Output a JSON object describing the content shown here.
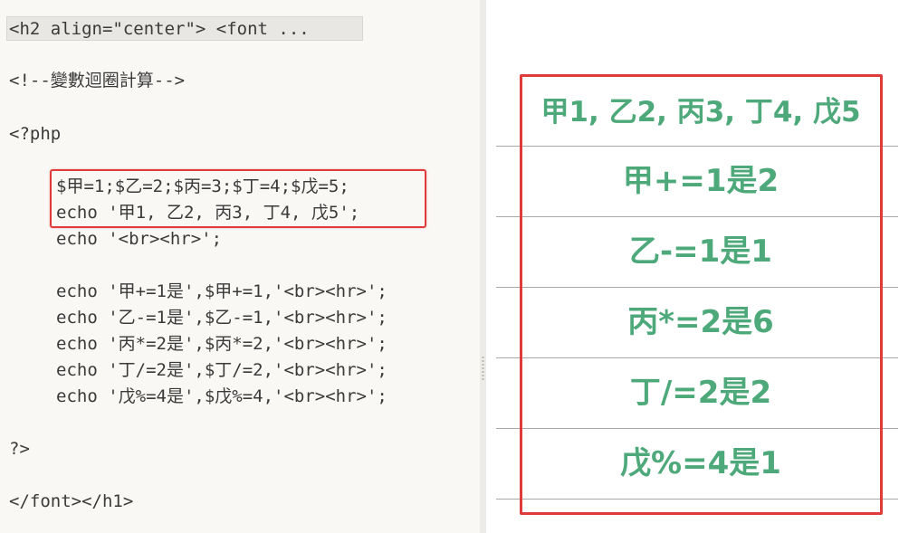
{
  "editor": {
    "lines": [
      "<h2 align=\"center\"> <font ...",
      "<!--變數迴圈計算-->",
      "<?php",
      "$甲=1;$乙=2;$丙=3;$丁=4;$戊=5;",
      "echo '甲1, 乙2, 丙3, 丁4, 戊5';",
      "echo '<br><hr>';",
      "echo '甲+=1是',$甲+=1,'<br><hr>';",
      "echo '乙-=1是',$乙-=1,'<br><hr>';",
      "echo '丙*=2是',$丙*=2,'<br><hr>';",
      "echo '丁/=2是',$丁/=2,'<br><hr>';",
      "echo '戊%=4是',$戊%=4,'<br><hr>';",
      "?>",
      "</font></h1>"
    ]
  },
  "preview": {
    "outputs": [
      "甲1, 乙2, 丙3, 丁4, 戊5",
      "甲+=1是2",
      "乙-=1是1",
      "丙*=2是6",
      "丁/=2是2",
      "戊%=4是1"
    ]
  },
  "colors": {
    "highlight": "#e03b3b",
    "output_text": "#4da87a",
    "editor_bg": "#f9f8f5"
  }
}
